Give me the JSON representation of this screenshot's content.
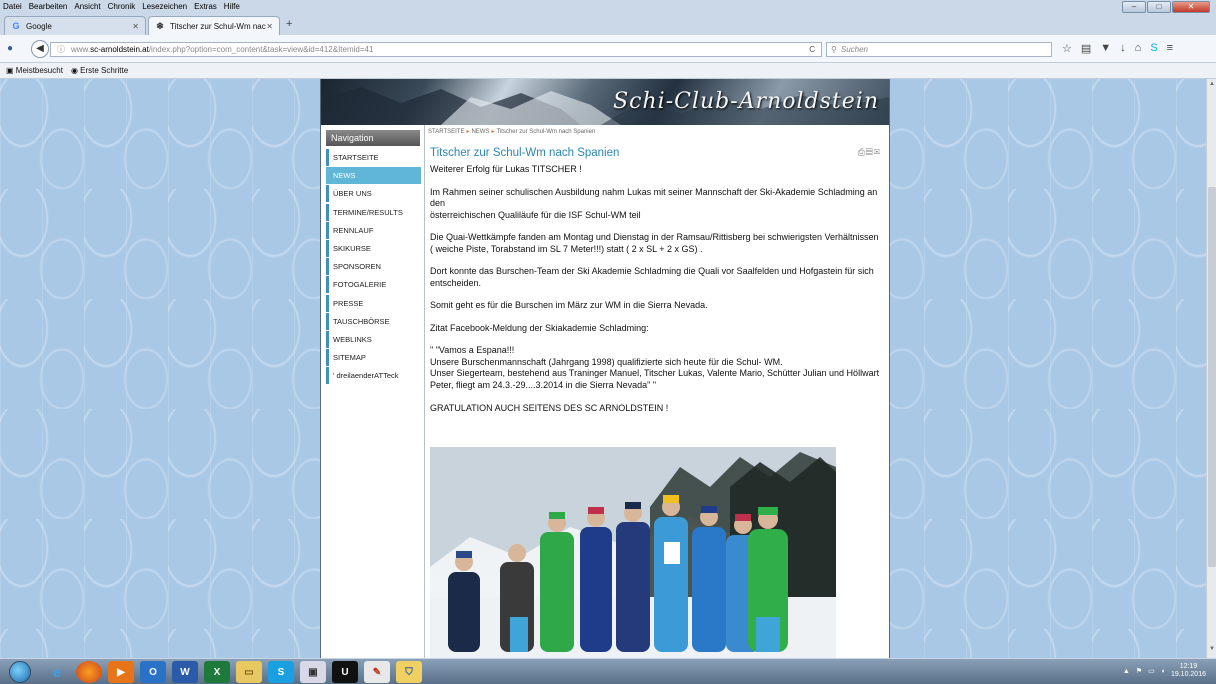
{
  "browser": {
    "menu": [
      "Datei",
      "Bearbeiten",
      "Ansicht",
      "Chronik",
      "Lesezeichen",
      "Extras",
      "Hilfe"
    ],
    "tabs": [
      {
        "title": "Google",
        "icon": "google-icon"
      },
      {
        "title": "Titscher zur Schul-Wm nac...",
        "icon": "snowflake-icon"
      }
    ],
    "url_prefix": "www.",
    "url_host": "sc-arnoldstein.at",
    "url_path": "/index.php?option=com_content&task=view&id=412&Itemid=41",
    "search_placeholder": "Suchen",
    "bookmarks": [
      "Meistbesucht",
      "Erste Schritte"
    ]
  },
  "site": {
    "banner_title": "Schi-Club-Arnoldstein",
    "nav_header": "Navigation",
    "nav_items": [
      {
        "label": "STARTSEITE",
        "active": false
      },
      {
        "label": "NEWS",
        "active": true
      },
      {
        "label": "ÜBER UNS",
        "active": false
      },
      {
        "label": "TERMINE/RESULTS",
        "active": false
      },
      {
        "label": "RENNLAUF",
        "active": false
      },
      {
        "label": "SKIKURSE",
        "active": false
      },
      {
        "label": "SPONSOREN",
        "active": false
      },
      {
        "label": "FOTOGALERIE",
        "active": false
      },
      {
        "label": "PRESSE",
        "active": false
      },
      {
        "label": "TAUSCHBÖRSE",
        "active": false
      },
      {
        "label": "WEBLINKS",
        "active": false
      },
      {
        "label": "SITEMAP",
        "active": false
      },
      {
        "label": "' dreilaenderATTeck",
        "active": false
      }
    ],
    "breadcrumb": [
      "STARTSEITE",
      "NEWS",
      "Titscher zur Schul-Wm nach Spanien"
    ],
    "article": {
      "title": "Titscher zur Schul-Wm nach Spanien",
      "subtitle": "Weiterer Erfolg für Lukas TITSCHER !",
      "p1": "Im Rahmen seiner schulischen Ausbildung nahm Lukas mit seiner Mannschaft der Ski-Akademie Schladming an den",
      "p1b": "österreichischen Qualiläufe für die ISF Schul-WM teil",
      "p2": "Die Quai-Wettkämpfe fanden am Montag und Dienstag in der Ramsau/Rittisberg bei schwierigsten Verhältnissen ( weiche Piste, Torabstand im SL 7 Meter!!!) statt ( 2 x SL + 2 x GS) .",
      "p3": "Dort konnte das Burschen-Team der Ski Akademie Schladming die Quali vor Saalfelden und Hofgastein für sich entscheiden.",
      "p4": "Somit geht es für die Burschen im März zur WM in die Sierra Nevada.",
      "p5": "Zitat Facebook-Meldung der Skiakademie Schladming:",
      "q1": "\" \"Vamos a Espana!!!",
      "q2": "Unsere Burschenmannschaft (Jahrgang 1998) qualifizierte sich heute für die Schul- WM.",
      "q3": "Unser Siegerteam, bestehend aus Traninger Manuel, Titscher Lukas, Valente Mario, Schütter Julian und Höllwart Peter, fliegt am 24.3.-29....3.2014 in die Sierra Nevada\" \"",
      "p6": "GRATULATION AUCH SEITENS DES SC ARNOLDSTEIN !"
    }
  },
  "taskbar": {
    "time": "12:19",
    "date": "19.10.2016"
  }
}
